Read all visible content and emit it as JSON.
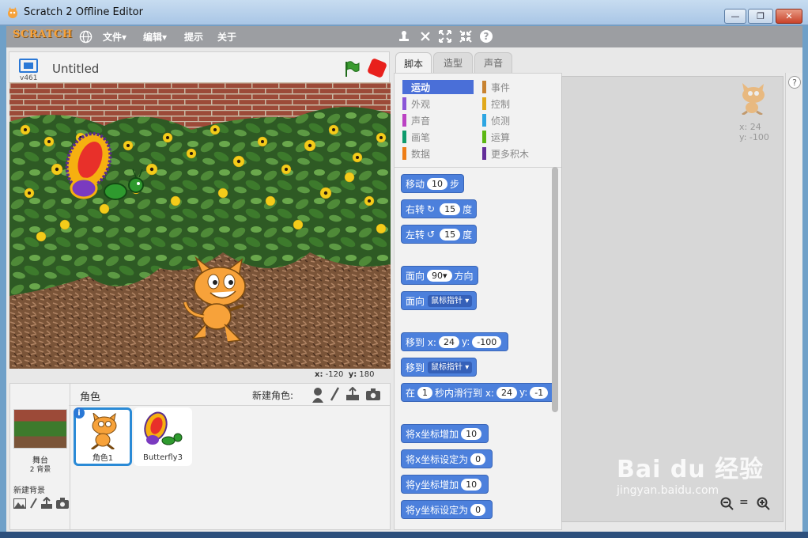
{
  "window": {
    "title": "Scratch 2 Offline Editor",
    "minimize": "—",
    "restore": "❐",
    "close": "✕"
  },
  "menubar": {
    "logo": "SCRATCH",
    "language_icon": "globe-icon",
    "items": [
      "文件▾",
      "编辑▾",
      "提示",
      "关于"
    ],
    "tools": [
      "duplicate-icon",
      "delete-icon",
      "grow-icon",
      "shrink-icon",
      "help-icon"
    ]
  },
  "stage": {
    "version": "v461",
    "project_title": "Untitled",
    "coords": {
      "x_label": "x:",
      "x": "-120",
      "y_label": "y:",
      "y": "180"
    }
  },
  "sprites": {
    "header": "角色",
    "new_sprite_label": "新建角色:",
    "stage_label": "舞台",
    "stage_backdrops": "2 背景",
    "new_backdrop_label": "新建背景",
    "items": [
      {
        "name": "角色1",
        "selected": true
      },
      {
        "name": "Butterfly3",
        "selected": false
      }
    ]
  },
  "tabs": [
    "脚本",
    "造型",
    "声音"
  ],
  "categories": {
    "left": [
      {
        "label": "运动",
        "color": "#4a6fd8",
        "active": true
      },
      {
        "label": "外观",
        "color": "#8a55d7"
      },
      {
        "label": "声音",
        "color": "#bb42c3"
      },
      {
        "label": "画笔",
        "color": "#0e9a6c"
      },
      {
        "label": "数据",
        "color": "#ee7d16"
      }
    ],
    "right": [
      {
        "label": "事件",
        "color": "#c88330"
      },
      {
        "label": "控制",
        "color": "#e1a91a"
      },
      {
        "label": "侦测",
        "color": "#2ca5e2"
      },
      {
        "label": "运算",
        "color": "#5cb712"
      },
      {
        "label": "更多积木",
        "color": "#632d99"
      }
    ]
  },
  "blocks": {
    "move": {
      "a": "移动",
      "n": "10",
      "b": "步"
    },
    "turn_right": {
      "a": "右转",
      "icon": "↻",
      "n": "15",
      "b": "度"
    },
    "turn_left": {
      "a": "左转",
      "icon": "↺",
      "n": "15",
      "b": "度"
    },
    "point_dir": {
      "a": "面向",
      "n": "90▾",
      "b": "方向"
    },
    "point_towards": {
      "a": "面向",
      "d": "鼠标指针 ▾"
    },
    "goto_xy": {
      "a": "移到 x:",
      "x": "24",
      "b": "y:",
      "y": "-100"
    },
    "goto": {
      "a": "移到",
      "d": "鼠标指针 ▾"
    },
    "glide": {
      "a": "在",
      "n": "1",
      "b": "秒内滑行到 x:",
      "x": "24",
      "c": "y:",
      "y": "-1"
    },
    "change_x": {
      "a": "将x坐标增加",
      "n": "10"
    },
    "set_x": {
      "a": "将x坐标设定为",
      "n": "0"
    },
    "change_y": {
      "a": "将y坐标增加",
      "n": "10"
    },
    "set_y": {
      "a": "将y坐标设定为",
      "n": "0"
    }
  },
  "script_area": {
    "sprite_x": "x: 24",
    "sprite_y": "y: -100",
    "zoom_out": "🔍−",
    "zoom_reset": "=",
    "zoom_in": "🔍+"
  },
  "watermark": {
    "brand": "Bai du 经验",
    "url": "jingyan.baidu.com"
  }
}
